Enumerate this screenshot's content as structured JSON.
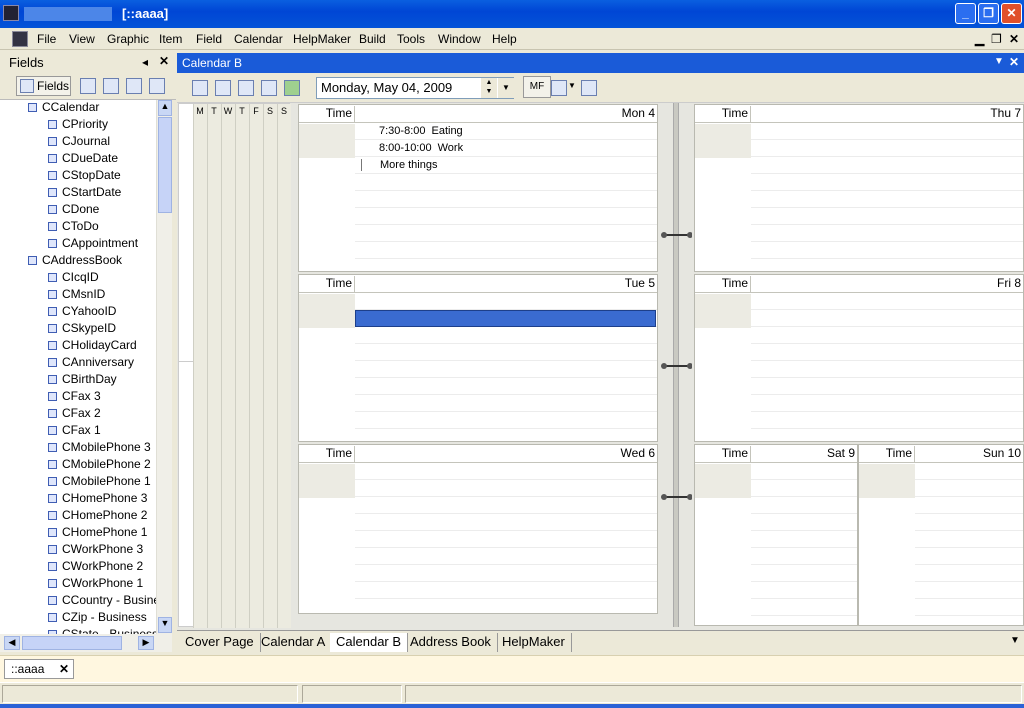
{
  "window": {
    "title": "[::aaaa]"
  },
  "menu": [
    "File",
    "View",
    "Graphic",
    "Item",
    "Field",
    "Calendar",
    "HelpMaker",
    "Build",
    "Tools",
    "Window",
    "Help"
  ],
  "fields_panel": {
    "title": "Fields",
    "fields_button": "Fields",
    "tree": [
      {
        "label": "CCalendar",
        "level": 0
      },
      {
        "label": "CPriority",
        "level": 1
      },
      {
        "label": "CJournal",
        "level": 1
      },
      {
        "label": "CDueDate",
        "level": 1
      },
      {
        "label": "CStopDate",
        "level": 1
      },
      {
        "label": "CStartDate",
        "level": 1
      },
      {
        "label": "CDone",
        "level": 1
      },
      {
        "label": "CToDo",
        "level": 1
      },
      {
        "label": "CAppointment",
        "level": 1
      },
      {
        "label": "CAddressBook",
        "level": 0
      },
      {
        "label": "CIcqID",
        "level": 1
      },
      {
        "label": "CMsnID",
        "level": 1
      },
      {
        "label": "CYahooID",
        "level": 1
      },
      {
        "label": "CSkypeID",
        "level": 1
      },
      {
        "label": "CHolidayCard",
        "level": 1
      },
      {
        "label": "CAnniversary",
        "level": 1
      },
      {
        "label": "CBirthDay",
        "level": 1
      },
      {
        "label": "CFax 3",
        "level": 1
      },
      {
        "label": "CFax 2",
        "level": 1
      },
      {
        "label": "CFax 1",
        "level": 1
      },
      {
        "label": "CMobilePhone 3",
        "level": 1
      },
      {
        "label": "CMobilePhone 2",
        "level": 1
      },
      {
        "label": "CMobilePhone 1",
        "level": 1
      },
      {
        "label": "CHomePhone 3",
        "level": 1
      },
      {
        "label": "CHomePhone 2",
        "level": 1
      },
      {
        "label": "CHomePhone 1",
        "level": 1
      },
      {
        "label": "CWorkPhone 3",
        "level": 1
      },
      {
        "label": "CWorkPhone 2",
        "level": 1
      },
      {
        "label": "CWorkPhone 1",
        "level": 1
      },
      {
        "label": "CCountry - Business",
        "level": 1
      },
      {
        "label": "CZip - Business",
        "level": 1
      },
      {
        "label": "CState - Business",
        "level": 1
      }
    ]
  },
  "document": {
    "title": "Calendar B",
    "date_value": "Monday, May 04, 2009",
    "mf_label": "MF"
  },
  "minical": {
    "days": [
      "M",
      "T",
      "W",
      "T",
      "F",
      "S",
      "S"
    ]
  },
  "calendar": {
    "time_label": "Time",
    "days": [
      {
        "date": "Mon 4",
        "appointments": [
          {
            "time": "7:30-8:00",
            "text": "Eating"
          },
          {
            "time": "8:00-10:00",
            "text": "Work"
          }
        ],
        "note": "More things"
      },
      {
        "date": "Tue 5",
        "selected_slot": true
      },
      {
        "date": "Wed 6"
      },
      {
        "date": "Thu 7"
      },
      {
        "date": "Fri 8"
      },
      {
        "date": "Sat 9"
      },
      {
        "date": "Sun 10"
      }
    ]
  },
  "tabs": [
    "Cover Page",
    "Calendar A",
    "Calendar B",
    "Address Book",
    "HelpMaker"
  ],
  "active_tab": "Calendar B",
  "bottom_tab": "::aaaa",
  "colors": {
    "title_blue": "#0046d5",
    "doc_header": "#1a5bd8",
    "selection": "#3a6bd0"
  }
}
